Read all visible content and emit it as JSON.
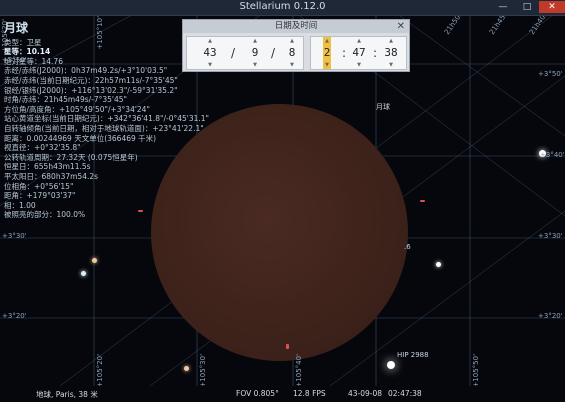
{
  "window": {
    "title": "Stellarium 0.12.0",
    "minimize": "—",
    "maximize": "□",
    "close": "✕"
  },
  "info": {
    "title": "月球",
    "lines": [
      "类型：卫星",
      "星等：10.14",
      "绝对星等：14.76",
      "赤经/赤纬(J2000)：0h37m49.2s/+3°10'03.5\"",
      "赤经/赤纬(当前日期纪元)：22h57m11s/-7°35'45\"",
      "银经/银纬(J2000)：+116°13'02.3\"/-59°31'35.2\"",
      "时角/赤纬：21h45m49s/-7°35'45\"",
      "方位角/高度角：+105°49'50\"/+3°34'24\"",
      "站心黄道坐标(当前日期纪元)：+342°36'41.8\"/-0°45'31.1\"",
      "自转轴倾角(当前日期，相对于地球轨道面)：+23°41'22.1\"",
      "距离：0.00244969 天文单位(366469 千米)",
      "视直径：+0°32'35.8\"",
      "公转轨道周期：27.32天 (0.075恒星年)",
      "恒星日：655h43m11.5s",
      "平太阳日：680h37m54.2s",
      "位相角：+0°56'15\"",
      "距角：+179°03'37\"",
      "相：1.00",
      "被照亮的部分：100.0%"
    ]
  },
  "date_dialog": {
    "title": "日期及时间",
    "close": "✕",
    "year": "43",
    "month": "9",
    "day": "8",
    "hour": "2",
    "minute": "47",
    "second": "38",
    "date_sep": "/",
    "time_sep": ":",
    "up": "▲",
    "down": "▼"
  },
  "sky_labels": {
    "moon_label": "月球",
    "star_label": "HIP 2988",
    "partial": ".6"
  },
  "grid_labels": {
    "top": [
      "+105°10'",
      "+105°20'",
      "+105°30'",
      "+105°40'",
      "+105°50'",
      "+106°00'",
      "+106°10'"
    ],
    "left": [
      "+3°50'",
      "+3°40'",
      "+3°30'",
      "+3°20'"
    ],
    "right": [
      "+3°50'",
      "+3°40'",
      "+3°30'",
      "+3°20'"
    ],
    "diag_top": [
      "21h50m",
      "21h45m",
      "21h40m"
    ],
    "bottom": [
      "+105°20'",
      "+105°30'",
      "+105°40'",
      "+105°50'"
    ]
  },
  "status": {
    "location": "地球, Paris, 38 米",
    "fov": "FOV 0.805°",
    "fps": "12.8 FPS",
    "date": "43-09-08",
    "time": "02:47:38"
  },
  "colors": {
    "moon": "#3e231b",
    "sky": "#05070c",
    "grid": "#8ca0b8"
  }
}
